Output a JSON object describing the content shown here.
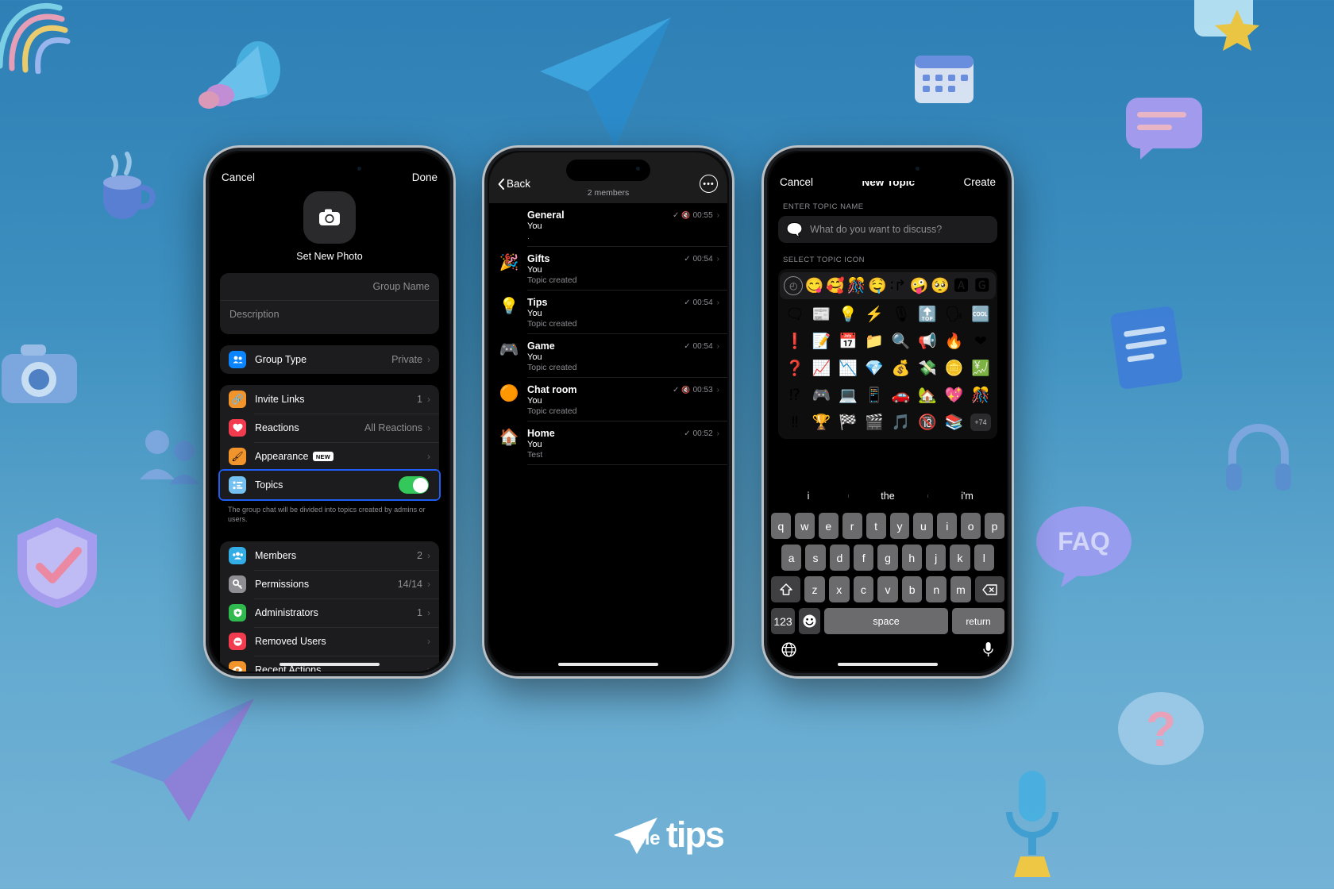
{
  "brand": {
    "mark": "➤",
    "name_part1": "ele",
    "name_part2": "tips"
  },
  "phone1": {
    "nav": {
      "cancel": "Cancel",
      "done": "Done"
    },
    "photo": {
      "icon": "camera-icon",
      "caption": "Set New Photo"
    },
    "fields": {
      "group_name_placeholder": "Group Name",
      "description_placeholder": "Description"
    },
    "group_type": {
      "label": "Group Type",
      "value": "Private",
      "icon": "👥",
      "icon_bg": "#0a84ff"
    },
    "settings": [
      {
        "label": "Invite Links",
        "value": "1",
        "icon": "🔗",
        "icon_bg": "#f0942b"
      },
      {
        "label": "Reactions",
        "value": "All Reactions",
        "icon": "♥",
        "icon_bg": "#f23b4f"
      },
      {
        "label": "Appearance",
        "value": "",
        "badge": "NEW",
        "icon": "🖌",
        "icon_bg": "#f0942b"
      }
    ],
    "topics_row": {
      "label": "Topics",
      "icon": "☰",
      "icon_bg": "#74c0f0",
      "toggle_on": true,
      "highlighted": true
    },
    "topics_note": "The group chat will be divided into topics created by admins or users.",
    "management": [
      {
        "label": "Members",
        "value": "2",
        "icon": "👥",
        "icon_bg": "#32ade6"
      },
      {
        "label": "Permissions",
        "value": "14/14",
        "icon": "🔑",
        "icon_bg": "#8e8e93"
      },
      {
        "label": "Administrators",
        "value": "1",
        "icon": "🛡",
        "icon_bg": "#30b94d"
      },
      {
        "label": "Removed Users",
        "value": "",
        "icon": "⛔",
        "icon_bg": "#f23b4f"
      },
      {
        "label": "Recent Actions",
        "value": "",
        "icon": "👁",
        "icon_bg": "#f0942b"
      }
    ],
    "chevron": "›"
  },
  "phone2": {
    "back_label": "Back",
    "subtitle": "2 members",
    "more_icon": "more-options-icon",
    "topics": [
      {
        "emoji": "#",
        "title": "General",
        "sender": "You",
        "preview": ".",
        "muted": true,
        "time": "00:55",
        "read": true
      },
      {
        "emoji": "🎉",
        "title": "Gifts",
        "sender": "You",
        "preview": "Topic created",
        "muted": false,
        "time": "00:54",
        "read": true
      },
      {
        "emoji": "💡",
        "title": "Tips",
        "sender": "You",
        "preview": "Topic created",
        "muted": false,
        "time": "00:54",
        "read": true
      },
      {
        "emoji": "🎮",
        "title": "Game",
        "sender": "You",
        "preview": "Topic created",
        "muted": false,
        "time": "00:54",
        "read": true
      },
      {
        "emoji": "🟠",
        "title": "Chat room",
        "sender": "You",
        "preview": "Topic created",
        "muted": true,
        "time": "00:53",
        "read": true
      },
      {
        "emoji": "🏠",
        "title": "Home",
        "sender": "You",
        "preview": "Test",
        "muted": false,
        "time": "00:52",
        "read": true
      }
    ]
  },
  "phone3": {
    "nav": {
      "cancel": "Cancel",
      "title": "New Topic",
      "create": "Create"
    },
    "name_section_label": "ENTER TOPIC NAME",
    "name_placeholder": "What do you want to discuss?",
    "name_icon": "🗨",
    "icon_section_label": "SELECT TOPIC ICON",
    "emoji_recent": [
      "clock",
      "😋",
      "🥰",
      "🎊",
      "🤤",
      "∶↱",
      "🤪",
      "🥺",
      "🅰",
      "🅶"
    ],
    "emoji_rows": [
      [
        "🗨",
        "📰",
        "💡",
        "⚡",
        "🎙",
        "🔝",
        "🗣",
        "🆒"
      ],
      [
        "❗",
        "📝",
        "📅",
        "📁",
        "🔍",
        "📢",
        "🔥",
        "❤"
      ],
      [
        "❓",
        "📈",
        "📉",
        "💎",
        "💰",
        "💸",
        "🪙",
        "💹"
      ],
      [
        "⁉",
        "🎮",
        "💻",
        "📱",
        "🚗",
        "🏡",
        "💖",
        "🎊"
      ],
      [
        "‼",
        "🏆",
        "🏁",
        "🎬",
        "🎵",
        "🔞",
        "📚",
        "+74"
      ]
    ],
    "emoji_more_badge": "+74",
    "keyboard": {
      "predictions": [
        "i",
        "the",
        "i'm"
      ],
      "row1": [
        "q",
        "w",
        "e",
        "r",
        "t",
        "y",
        "u",
        "i",
        "o",
        "p"
      ],
      "row2": [
        "a",
        "s",
        "d",
        "f",
        "g",
        "h",
        "j",
        "k",
        "l"
      ],
      "row3": [
        "z",
        "x",
        "c",
        "v",
        "b",
        "n",
        "m"
      ],
      "shift": "⇧",
      "backspace": "⌫",
      "numbers": "123",
      "emoji_key": "☺",
      "space": "space",
      "return": "return",
      "globe": "🌐",
      "mic": "🎤"
    }
  }
}
